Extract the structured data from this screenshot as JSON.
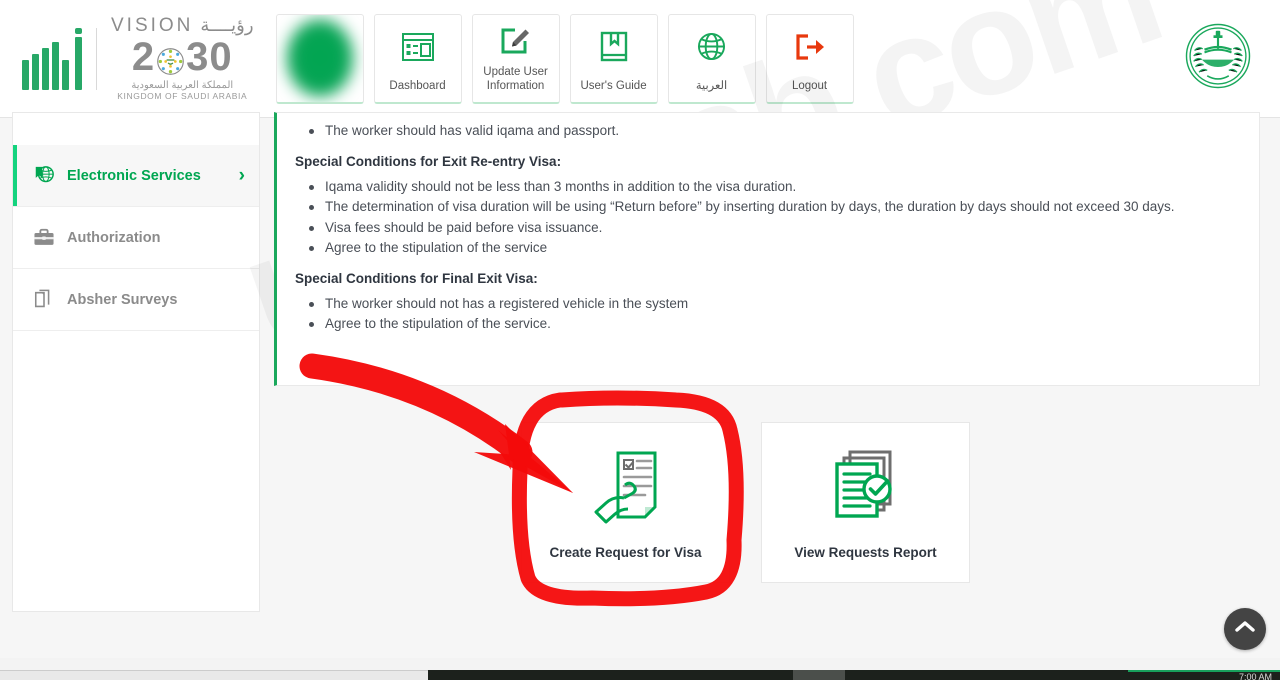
{
  "brand": {
    "vision_word": "VISION",
    "vision_arabic": "رؤيــــة",
    "vision_year": "2030",
    "kingdom_arabic": "المملكة العربية السعودية",
    "kingdom_english": "KINGDOM OF SAUDI ARABIA",
    "emblem_name": "ministry-of-interior-emblem"
  },
  "nav": {
    "tabs": [
      {
        "label": "",
        "icon": "redacted-blob",
        "redacted": true
      },
      {
        "label": "Dashboard",
        "icon": "dashboard-icon"
      },
      {
        "label": "Update User Information",
        "icon": "edit-pencil-icon"
      },
      {
        "label": "User's Guide",
        "icon": "book-icon"
      },
      {
        "label": "العربية",
        "icon": "globe-icon"
      },
      {
        "label": "Logout",
        "icon": "logout-icon"
      }
    ]
  },
  "sidebar": {
    "items": [
      {
        "label": "Electronic Services",
        "icon": "globe-flag-icon",
        "active": true,
        "chevron": "›"
      },
      {
        "label": "Authorization",
        "icon": "briefcase-icon",
        "active": false
      },
      {
        "label": "Absher Surveys",
        "icon": "documents-icon",
        "active": false
      }
    ]
  },
  "content": {
    "clipped_bullet": "The worker should has valid iqama and passport.",
    "sections": [
      {
        "heading": "Special Conditions for Exit Re-entry Visa:",
        "bullets": [
          "Iqama validity should not be less than 3 months in addition to the visa duration.",
          "The determination of visa duration will be using “Return before” by inserting duration by days, the duration by days should not exceed 30 days.",
          "Visa fees should be paid before visa issuance.",
          "Agree to the stipulation of the service"
        ]
      },
      {
        "heading": "Special Conditions for Final Exit Visa:",
        "bullets": [
          "The worker should not has a registered vehicle in the system",
          "Agree to the stipulation of the service."
        ]
      }
    ]
  },
  "cards": [
    {
      "label": "Create Request for Visa",
      "icon": "hand-signing-document-icon",
      "highlighted": true
    },
    {
      "label": "View Requests Report",
      "icon": "documents-check-icon",
      "highlighted": false
    }
  ],
  "watermark": {
    "text": "urduarab.com"
  },
  "scroll_top": {
    "icon": "chevron-up-icon"
  },
  "taskbar": {
    "clock": "7:00 AM"
  },
  "colors": {
    "brand_green": "#00a651",
    "accent_green": "#14d37e",
    "logout_red": "#e8380d",
    "annotation_red": "#f40a0a",
    "text_dark": "#2f3640",
    "text_muted": "#8b8b8b"
  }
}
